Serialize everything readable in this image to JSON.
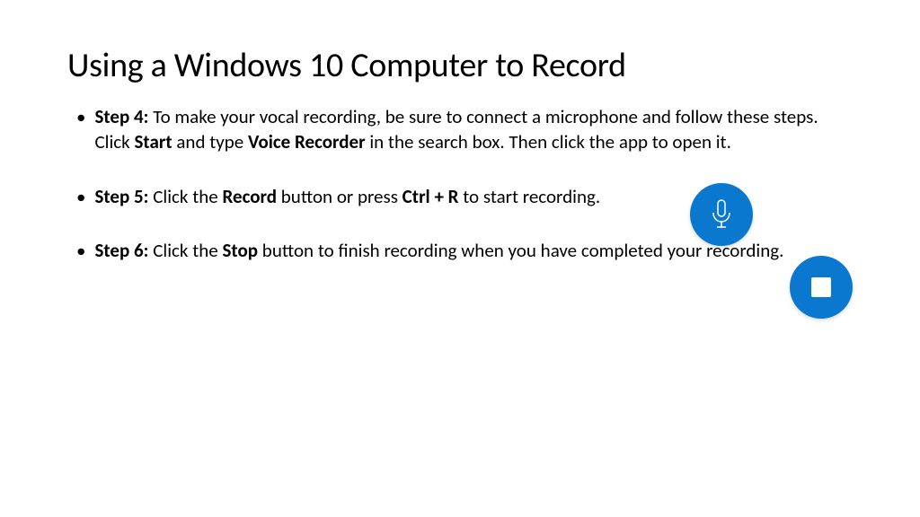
{
  "title": "Using a Windows 10 Computer to Record",
  "steps": {
    "step4": {
      "label": "Step 4:",
      "text_a": " To make your vocal recording, be sure to connect a microphone and follow these steps.  Click ",
      "bold_1": "Start",
      "text_b": " and type ",
      "bold_2": "Voice Recorder",
      "text_c": " in the search box.  Then click the app to open it."
    },
    "step5": {
      "label": "Step 5:",
      "text_a": " Click the ",
      "bold_1": "Record",
      "text_b": " button or press ",
      "bold_2": "Ctrl + R",
      "text_c": " to start recording."
    },
    "step6": {
      "label": "Step 6:",
      "text_a": " Click the ",
      "bold_1": "Stop",
      "text_b": " button to finish recording when you have completed your recording."
    }
  },
  "icons": {
    "record_color": "#0B78D0",
    "stop_color": "#0B78D0"
  }
}
